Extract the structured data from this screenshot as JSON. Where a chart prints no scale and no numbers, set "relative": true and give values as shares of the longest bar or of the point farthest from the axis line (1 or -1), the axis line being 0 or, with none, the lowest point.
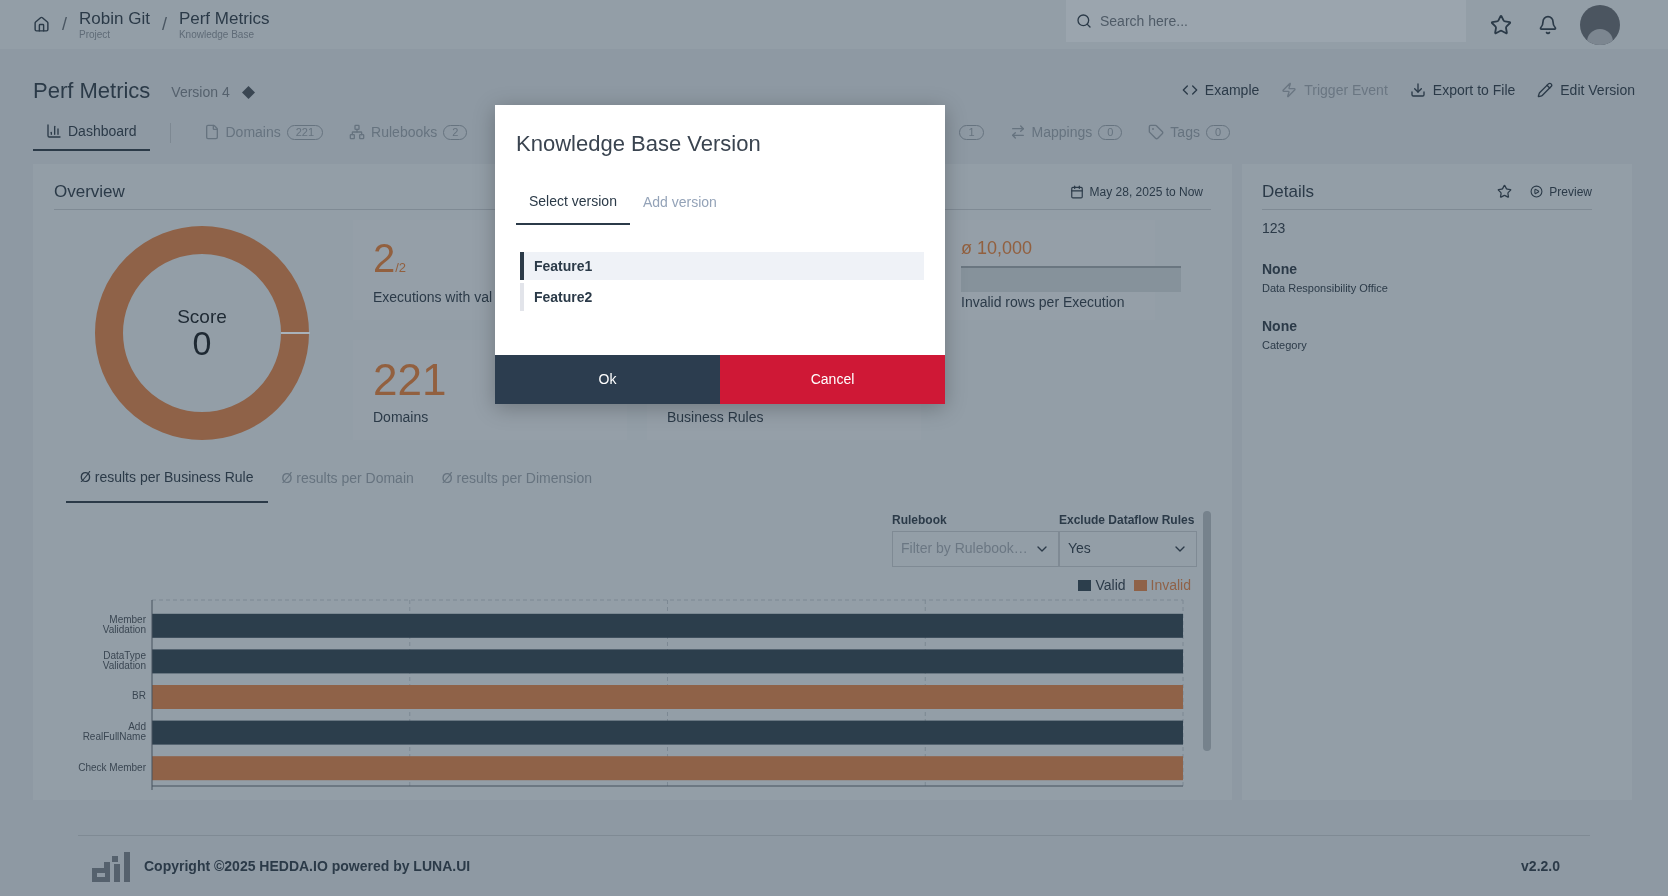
{
  "header": {
    "separator": "/",
    "breadcrumbs": [
      {
        "title": "Robin Git",
        "subtitle": "Project"
      },
      {
        "title": "Perf Metrics",
        "subtitle": "Knowledge Base"
      }
    ],
    "search": {
      "placeholder": "Search here..."
    }
  },
  "page": {
    "title": "Perf Metrics",
    "version": "Version 4",
    "actions": [
      {
        "kind": "code",
        "label": "Example",
        "disabled": false
      },
      {
        "kind": "event",
        "label": "Trigger Event",
        "disabled": true
      },
      {
        "kind": "export",
        "label": "Export to File",
        "disabled": false
      },
      {
        "kind": "edit",
        "label": "Edit Version",
        "disabled": false
      }
    ]
  },
  "tabs": [
    {
      "kind": "chart",
      "label": "Dashboard",
      "selected": true
    },
    {
      "kind": "file",
      "label": "Domains",
      "count": "221",
      "selected": false
    },
    {
      "kind": "tree",
      "label": "Rulebooks",
      "count": "2",
      "selected": false
    },
    {
      "kind": "covered",
      "count": "1",
      "selected": false
    },
    {
      "kind": "swap",
      "label": "Mappings",
      "count": "0",
      "selected": false
    },
    {
      "kind": "tag",
      "label": "Tags",
      "count": "0",
      "selected": false
    }
  ],
  "overview": {
    "title": "Overview",
    "date_range": "May 28, 2025 to Now",
    "score": {
      "label": "Score",
      "value": "0"
    },
    "stats": [
      {
        "kind": "fraction",
        "value": "2",
        "total": "/2",
        "label": "Executions with val"
      },
      {
        "kind": "average",
        "value": "ø 10,000",
        "label": "Invalid rows per Execution"
      },
      {
        "kind": "count",
        "value": "221",
        "label": "Domains"
      },
      {
        "kind": "label_only",
        "label": "Business Rules"
      }
    ],
    "chart_tabs": [
      {
        "label": "Ø results per Business Rule",
        "selected": true
      },
      {
        "label": "Ø results per Domain",
        "selected": false
      },
      {
        "label": "Ø results per Dimension",
        "selected": false
      }
    ],
    "filters": [
      {
        "label": "Rulebook",
        "placeholder": "Filter by Rulebook…"
      },
      {
        "label": "Exclude Dataflow Rules",
        "value": "Yes"
      }
    ],
    "chart_data": {
      "type": "bar",
      "orientation": "horizontal",
      "stacked": true,
      "relative": true,
      "categories": [
        "Member Validation",
        "DataType Validation",
        "BR",
        "Add RealFullName",
        "Check Member"
      ],
      "series": [
        {
          "name": "Valid",
          "color": "#2c3e4c",
          "values": [
            1,
            1,
            0,
            1,
            0
          ]
        },
        {
          "name": "Invalid",
          "color": "#8f6248",
          "values": [
            0,
            0,
            1,
            0,
            1
          ]
        }
      ]
    }
  },
  "details": {
    "title": "Details",
    "preview": "Preview",
    "id": "123",
    "fields": [
      {
        "value": "None",
        "label": "Data Responsibility Office"
      },
      {
        "value": "None",
        "label": "Category"
      }
    ]
  },
  "modal": {
    "title": "Knowledge Base Version",
    "tabs": [
      {
        "label": "Select version",
        "selected": true
      },
      {
        "label": "Add version",
        "selected": false
      }
    ],
    "versions": [
      {
        "label": "Feature1",
        "selected": true
      },
      {
        "label": "Feature2",
        "selected": false
      }
    ],
    "buttons": [
      {
        "kind": "ok",
        "label": "Ok"
      },
      {
        "kind": "cancel",
        "label": "Cancel"
      }
    ]
  },
  "footer": {
    "copyright": "Copyright ©2025 HEDDA.IO powered by LUNA.UI",
    "version": "v2.2.0"
  }
}
